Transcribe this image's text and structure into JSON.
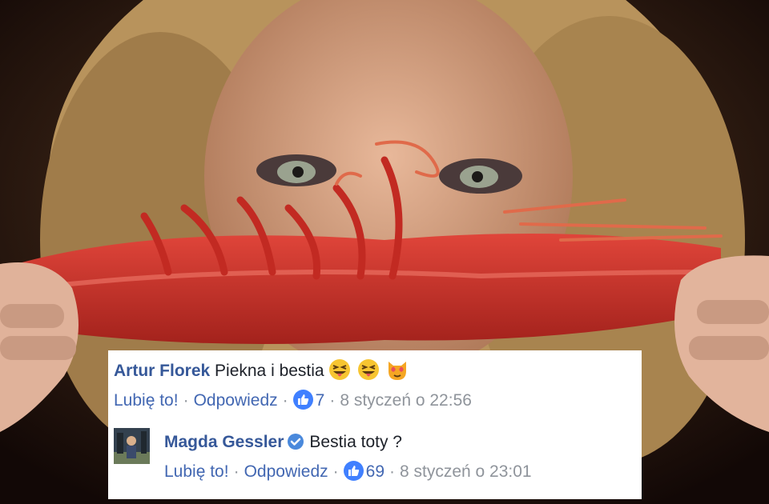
{
  "comments": [
    {
      "author": "Artur Florek",
      "text": "Piekna i bestia",
      "emojis": [
        "squinting-tongue-emoji",
        "squinting-tongue-emoji",
        "heart-eyes-cat-emoji"
      ],
      "like_label": "Lubię to!",
      "reply_label": "Odpowiedz",
      "likes": "7",
      "timestamp": "8 styczeń o 22:56"
    },
    {
      "author": "Magda Gessler",
      "verified": true,
      "text": "Bestia toty ?",
      "like_label": "Lubię to!",
      "reply_label": "Odpowiedz",
      "likes": "69",
      "timestamp": "8 styczeń o 23:01"
    }
  ],
  "colors": {
    "author": "#365899",
    "link": "#4267b2",
    "meta": "#8f949b",
    "like_badge": "#4080ff"
  }
}
